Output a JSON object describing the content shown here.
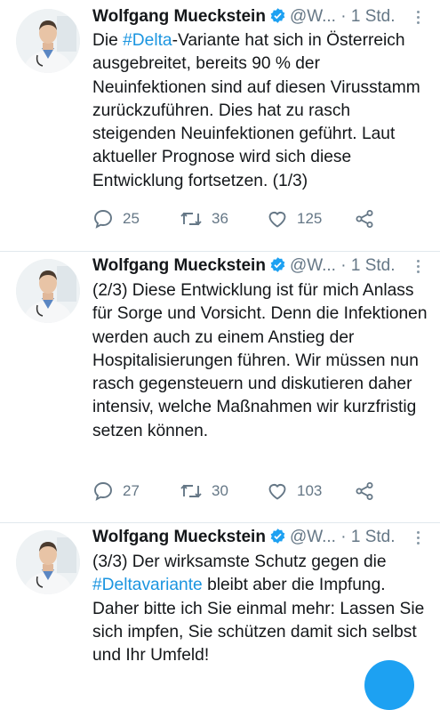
{
  "tweets": [
    {
      "author_name": "Wolfgang Mueckstein",
      "handle": "@W...",
      "separator": "·",
      "time": "1 Std.",
      "text_before": "Die ",
      "hashtag": "#Delta",
      "text_after": "-Variante hat sich in Österreich ausgebreitet, bereits 90 % der Neuinfektionen sind auf diesen Virusstamm zurückzuführen. Dies hat zu rasch steigenden Neuinfektionen geführt. Laut aktueller Prognose wird sich diese Entwicklung fortsetzen. (1/3)",
      "replies": "25",
      "retweets": "36",
      "likes": "125"
    },
    {
      "author_name": "Wolfgang Mueckstein",
      "handle": "@W...",
      "separator": "·",
      "time": "1 Std.",
      "text_before": "(2/3) Diese Entwicklung ist für mich Anlass für Sorge und Vorsicht. Denn die Infektionen werden auch zu einem Anstieg der Hospitalisierungen führen. Wir müssen nun rasch gegensteuern und diskutieren daher intensiv, welche Maßnahmen wir kurzfristig setzen können.",
      "hashtag": "",
      "text_after": "",
      "replies": "27",
      "retweets": "30",
      "likes": "103"
    },
    {
      "author_name": "Wolfgang Mueckstein",
      "handle": "@W...",
      "separator": "·",
      "time": "1 Std.",
      "text_before": "(3/3) Der wirksamste Schutz gegen die ",
      "hashtag": "#Deltavariante",
      "text_after": " bleibt aber die Impfung. Daher bitte ich Sie einmal mehr: Lassen Sie sich impfen, Sie schützen damit sich selbst und Ihr Umfeld!",
      "replies": "",
      "retweets": "",
      "likes": ""
    }
  ],
  "colors": {
    "accent": "#1da1f2",
    "hashtag": "#1b95e0",
    "secondary_text": "#657786",
    "divider": "#e1e8ed"
  },
  "icons": [
    "verified-badge-icon",
    "more-options-icon",
    "reply-icon",
    "retweet-icon",
    "like-icon",
    "share-icon"
  ]
}
